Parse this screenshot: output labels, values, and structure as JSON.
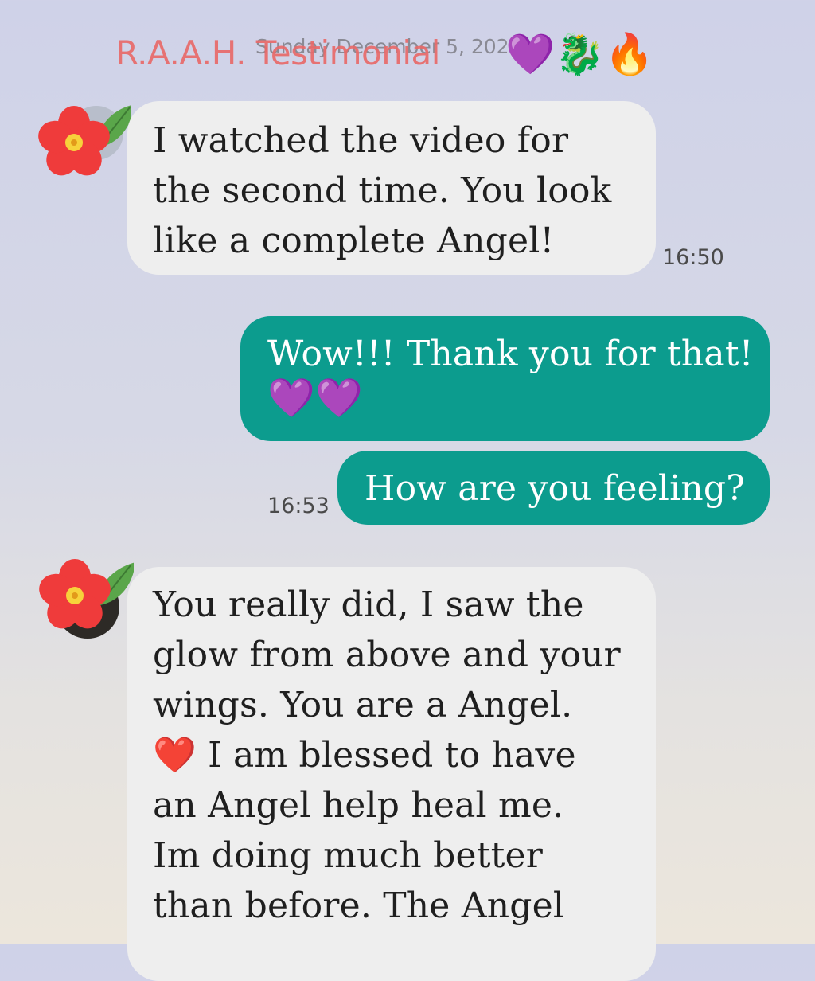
{
  "header": {
    "date_label": "Sunday December 5, 2021",
    "overlay_title": "R.A.A.H. Testimonial",
    "overlay_emojis": "💜🐉🔥"
  },
  "messages": [
    {
      "direction": "incoming",
      "lines": [
        "I watched the video for",
        "the second time. You look",
        "like a complete Angel!"
      ],
      "time": "16:50"
    },
    {
      "direction": "outgoing",
      "lines": [
        "Wow!!! Thank you for that!",
        "💜💜"
      ]
    },
    {
      "direction": "outgoing",
      "lines": [
        "How are you feeling?"
      ],
      "time": "16:53"
    },
    {
      "direction": "incoming",
      "lines": [
        "You really did, I saw the",
        "glow from above and your",
        "wings. You are a Angel.",
        "❤️ I am blessed to have",
        "an Angel help heal me.",
        "Im doing much better",
        "than before. The Angel"
      ]
    }
  ],
  "colors": {
    "incoming_bubble": "#eeeeee",
    "outgoing_bubble": "#0c9c8e",
    "title_overlay": "#e86a6a"
  },
  "icons": {
    "avatar": "red-flower-icon"
  }
}
